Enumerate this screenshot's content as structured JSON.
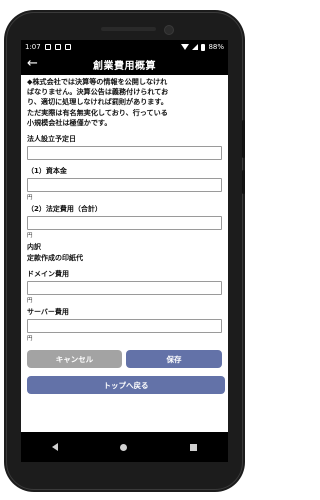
{
  "status_bar": {
    "time": "1:07",
    "battery": "88%"
  },
  "header": {
    "back_glyph": "←",
    "title": "創業費用概算"
  },
  "note_lines": [
    "◆株式会社では決算等の情報を公開しなけれ",
    "ばなりません。決算公告は義務付けられてお",
    "り、適切に処理しなければ罰則があります。",
    "ただ実際は有名無実化しており、行っている",
    "小規模会社は極僅かです。"
  ],
  "form": {
    "establish_label": "法人設立予定日",
    "capital_label": "（1）資本金",
    "capital_unit": "円",
    "legal_label": "（2）法定費用（合計）",
    "legal_unit": "円",
    "breakdown_label": "内訳",
    "stamp_label": "定款作成の印紙代",
    "domain_label": "ドメイン費用",
    "domain_unit": "円",
    "server_label": "サーバー費用",
    "server_unit": "円"
  },
  "buttons": {
    "cancel": "キャンセル",
    "save": "保存",
    "top": "トップへ戻る"
  }
}
